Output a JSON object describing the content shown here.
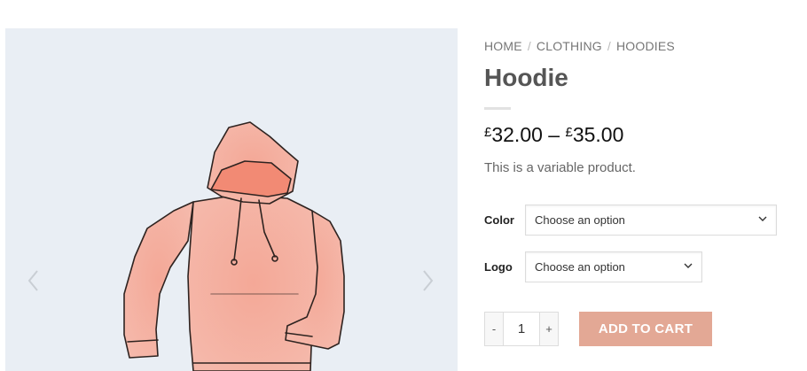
{
  "breadcrumb": {
    "home": "HOME",
    "category": "CLOTHING",
    "subcategory": "HOODIES",
    "separator": "/"
  },
  "product": {
    "title": "Hoodie",
    "price_currency": "£",
    "price_min": "32.00",
    "price_max": "35.00",
    "price_dash": "–",
    "description": "This is a variable product.",
    "image_icon": "hoodie-illustration"
  },
  "options": {
    "color": {
      "label": "Color",
      "value": "Choose an option"
    },
    "logo": {
      "label": "Logo",
      "value": "Choose an option"
    }
  },
  "cart": {
    "minus": "-",
    "quantity": "1",
    "plus": "+",
    "add_label": "ADD TO CART",
    "button_color": "#e3a895"
  },
  "gallery": {
    "prev_icon": "chevron-left-icon",
    "next_icon": "chevron-right-icon",
    "background": "#e9eef4"
  }
}
